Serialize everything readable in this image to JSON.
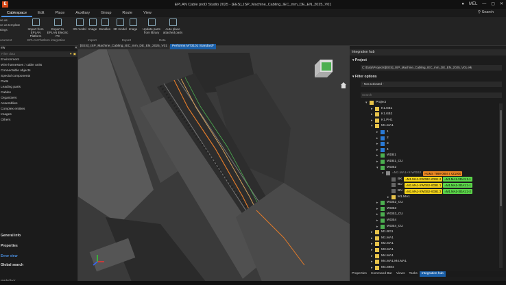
{
  "window": {
    "title": "EPLAN Cable proD Studio 2025 - [EES]_ISP_Machine_Cabling_IEC_mm_DE_EN_2025_V01",
    "user": "MEL"
  },
  "menu": {
    "items": [
      "Cablespace",
      "Edit",
      "Place",
      "Auxiliary",
      "Group",
      "Route",
      "View"
    ],
    "search": "Search"
  },
  "ribbon": {
    "left_items": [
      "ve as",
      "ve as template",
      "ttings",
      "ocument"
    ],
    "buttons": [
      {
        "label": "Import from EPLAN Platform"
      },
      {
        "label": "Export to EPLAN Electric P8"
      },
      {
        "label": "3D model"
      },
      {
        "label": "Image"
      },
      {
        "label": "Bundles"
      },
      {
        "label": "3D model"
      },
      {
        "label": "Image"
      },
      {
        "label": "Update parts from library"
      },
      {
        "label": "Auto place attached parts"
      }
    ],
    "groups": [
      "EPLAN Platform integration",
      "Import",
      "Export",
      "Data"
    ]
  },
  "left": {
    "header": "ew",
    "filter": "Filter data",
    "items": [
      "Environment",
      "Wire harnesses / cable units",
      "Connectable objects",
      "Special components",
      "Parts",
      "Leading parts",
      "Cables",
      "Organizers",
      "Assemblies",
      "Complex entities",
      "Images",
      "Others"
    ],
    "sections": [
      "General info",
      "Properties",
      "Error view",
      "Global search"
    ],
    "status": "ready/door"
  },
  "tabs": [
    "[EES]_ISP_Machine_Cabling_IEC_mm_DE_EN_2025_V01",
    "Performs MT3101 Standard*"
  ],
  "hub": {
    "title": "Integration hub",
    "project_label": "Project",
    "project_path": "C:\\Data\\Projects\\[EES]_ISP_Machine_Cabling_IEC_mm_DE_EN_2025_V01.elk",
    "filter_label": "Filter options",
    "filter_value": "- Not activated -",
    "search_placeholder": "Search",
    "tree": [
      {
        "label": "Project",
        "indent": 0,
        "type": "folder",
        "tw": "▾"
      },
      {
        "label": "K1.KB1",
        "indent": 1,
        "type": "yellow",
        "tw": "▸"
      },
      {
        "label": "K1.KB2",
        "indent": 1,
        "type": "yellow",
        "tw": "▸"
      },
      {
        "label": "K1.PH1",
        "indent": 1,
        "type": "yellow",
        "tw": "▸"
      },
      {
        "label": "M1.MA1",
        "indent": 1,
        "type": "yellow",
        "tw": "▾"
      },
      {
        "label": "1",
        "indent": 2,
        "type": "blue",
        "tw": "▸"
      },
      {
        "label": "2",
        "indent": 2,
        "type": "blue",
        "tw": "▸"
      },
      {
        "label": "3",
        "indent": 2,
        "type": "blue",
        "tw": "▸"
      },
      {
        "label": "4",
        "indent": 2,
        "type": "blue",
        "tw": "▸"
      },
      {
        "label": "WDB1",
        "indent": 2,
        "type": "green",
        "tw": "▸"
      },
      {
        "label": "WDB1_CU",
        "indent": 2,
        "type": "green",
        "tw": "▸"
      },
      {
        "label": "WGB2",
        "indent": 2,
        "type": "green",
        "tw": "▾"
      },
      {
        "label": "=M1.MA1+X-WGB2",
        "indent": 3,
        "type": "grey",
        "tw": "▾",
        "tags": [
          {
            "text": "HUMS 7999-0804 I XZ1000",
            "color": "#f08a24"
          }
        ]
      },
      {
        "label": "BK",
        "indent": 4,
        "type": "wire",
        "tw": "",
        "tags": [
          {
            "text": "=M1.MA1-XWGB2-XDB1:4",
            "color": "#f5d51a"
          },
          {
            "text": "=M1.MA1-XDA1:1-1",
            "color": "#5cd64a"
          }
        ]
      },
      {
        "label": "BU",
        "indent": 4,
        "type": "wire",
        "tw": "",
        "tags": [
          {
            "text": "=M1.MA1-XWGB2-XDB1:1",
            "color": "#f5d51a"
          },
          {
            "text": "=M1.MA1-XDA1:1-1",
            "color": "#5cd64a"
          }
        ]
      },
      {
        "label": "BN",
        "indent": 4,
        "type": "wire",
        "tw": "",
        "tags": [
          {
            "text": "=M1.MA1-XWGB2-XDB1:3",
            "color": "#f5d51a"
          },
          {
            "text": "=M1.MA1-XDA1:1-2",
            "color": "#5cd64a"
          }
        ]
      },
      {
        "label": "M1.MA1",
        "indent": 4,
        "type": "yellow",
        "tw": "▸"
      },
      {
        "label": "WGB2_CU",
        "indent": 2,
        "type": "green",
        "tw": "▸"
      },
      {
        "label": "WGB3",
        "indent": 2,
        "type": "green",
        "tw": "▸"
      },
      {
        "label": "WGB3_CU",
        "indent": 2,
        "type": "green",
        "tw": "▸"
      },
      {
        "label": "WGB4",
        "indent": 2,
        "type": "green",
        "tw": "▸"
      },
      {
        "label": "WGB4_CU",
        "indent": 2,
        "type": "green",
        "tw": "▸"
      },
      {
        "label": "M1.BG1",
        "indent": 1,
        "type": "yellow",
        "tw": "▸"
      },
      {
        "label": "M1.MA1",
        "indent": 1,
        "type": "yellow",
        "tw": "▸"
      },
      {
        "label": "M2.MA1",
        "indent": 1,
        "type": "yellow",
        "tw": "▸"
      },
      {
        "label": "M3.MA1",
        "indent": 1,
        "type": "yellow",
        "tw": "▸"
      },
      {
        "label": "M4.MA1",
        "indent": 1,
        "type": "yellow",
        "tw": "▸"
      },
      {
        "label": "M4.MA1;M4.MA1",
        "indent": 1,
        "type": "yellow",
        "tw": "▸"
      },
      {
        "label": "M4.MM4",
        "indent": 1,
        "type": "yellow",
        "tw": "▸"
      }
    ]
  },
  "bottom_tabs": [
    "Properties",
    "Command Bar",
    "Views",
    "Tasks",
    "Integration hub"
  ],
  "colors": {
    "accent": "#1a5fa8",
    "yellow": "#e8c34a",
    "green": "#4caf50",
    "blue": "#2a7ad5",
    "orange_tag": "#f08a24",
    "yellow_tag": "#f5d51a",
    "green_tag": "#5cd64a"
  }
}
